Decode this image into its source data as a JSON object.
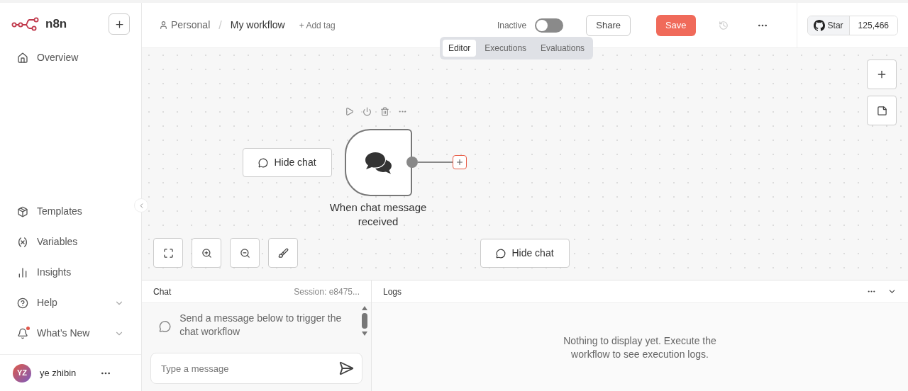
{
  "sidebar": {
    "logo": "n8n",
    "top_items": [
      {
        "label": "Overview"
      }
    ],
    "bottom_items": [
      {
        "label": "Templates",
        "expandable": false,
        "notification": false
      },
      {
        "label": "Variables",
        "expandable": false,
        "notification": false
      },
      {
        "label": "Insights",
        "expandable": false,
        "notification": false
      },
      {
        "label": "Help",
        "expandable": true,
        "notification": false
      },
      {
        "label": "What’s New",
        "expandable": true,
        "notification": true
      }
    ],
    "user": {
      "initials": "YZ",
      "name": "ye zhibin"
    }
  },
  "header": {
    "project": "Personal",
    "separator": "/",
    "workflow": "My workflow",
    "add_tag": "+ Add tag",
    "status_label": "Inactive",
    "active": false,
    "share": "Share",
    "save": "Save",
    "github": {
      "label": "Star",
      "count": "125,466"
    }
  },
  "tabs": [
    {
      "label": "Editor",
      "selected": true
    },
    {
      "label": "Executions",
      "selected": false
    },
    {
      "label": "Evaluations",
      "selected": false
    }
  ],
  "canvas": {
    "node": {
      "label": "When chat message received"
    },
    "hide_chat_buttons": [
      "Hide chat",
      "Hide chat"
    ]
  },
  "chat": {
    "title": "Chat",
    "session": "Session: e8475...",
    "empty_message": "Send a message below to trigger the chat workflow",
    "input": {
      "placeholder": "Type a message"
    }
  },
  "logs": {
    "title": "Logs",
    "empty_message": "Nothing to display yet. Execute the workflow to see execution logs."
  }
}
